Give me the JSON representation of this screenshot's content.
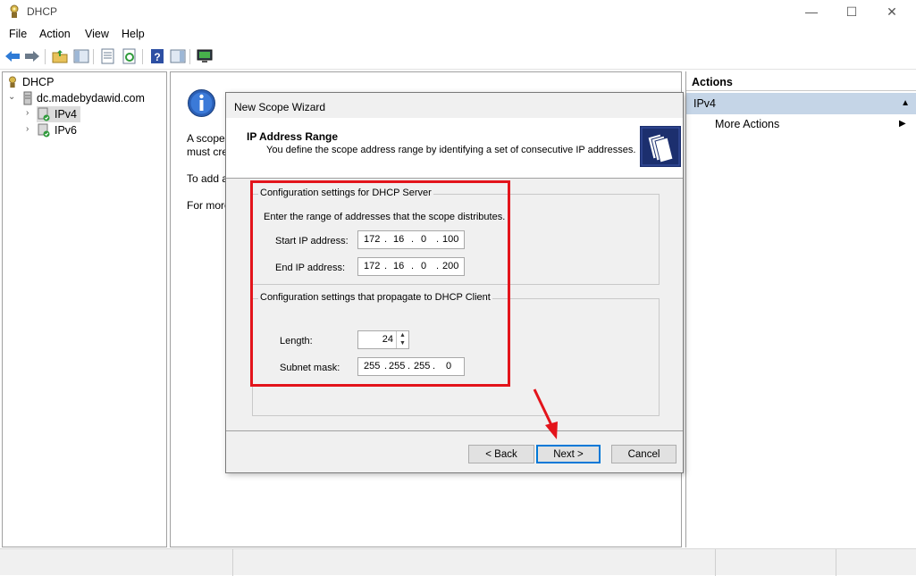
{
  "window": {
    "title": "DHCP",
    "minimize": "—",
    "maximize": "☐",
    "close": "✕"
  },
  "menu": [
    "File",
    "Action",
    "View",
    "Help"
  ],
  "tree": {
    "root": "DHCP",
    "server": "dc.madebydawid.com",
    "ipv4": "IPv4",
    "ipv6": "IPv6"
  },
  "center": {
    "line1": "A scope",
    "line2": "must cre",
    "line3": "To add a",
    "line4": "For more"
  },
  "actions": {
    "header": "Actions",
    "section": "IPv4",
    "more": "More Actions"
  },
  "wizard": {
    "title": "New Scope Wizard",
    "heading": "IP Address Range",
    "subtitle": "You define the scope address range by identifying a set of consecutive IP addresses.",
    "server_group": "Configuration settings for DHCP Server",
    "server_intro": "Enter the range of addresses that the scope distributes.",
    "start_label": "Start IP address:",
    "start_ip": [
      "172",
      "16",
      "0",
      "100"
    ],
    "end_label": "End IP address:",
    "end_ip": [
      "172",
      "16",
      "0",
      "200"
    ],
    "client_group": "Configuration settings that propagate to DHCP Client",
    "length_label": "Length:",
    "length_value": "24",
    "mask_label": "Subnet mask:",
    "mask": [
      "255",
      "255",
      "255",
      "0"
    ],
    "back": "< Back",
    "next": "Next >",
    "cancel": "Cancel"
  },
  "colors": {
    "highlight": "#e3141b",
    "accent": "#0078d7",
    "action_selected": "#c5d5e7"
  }
}
